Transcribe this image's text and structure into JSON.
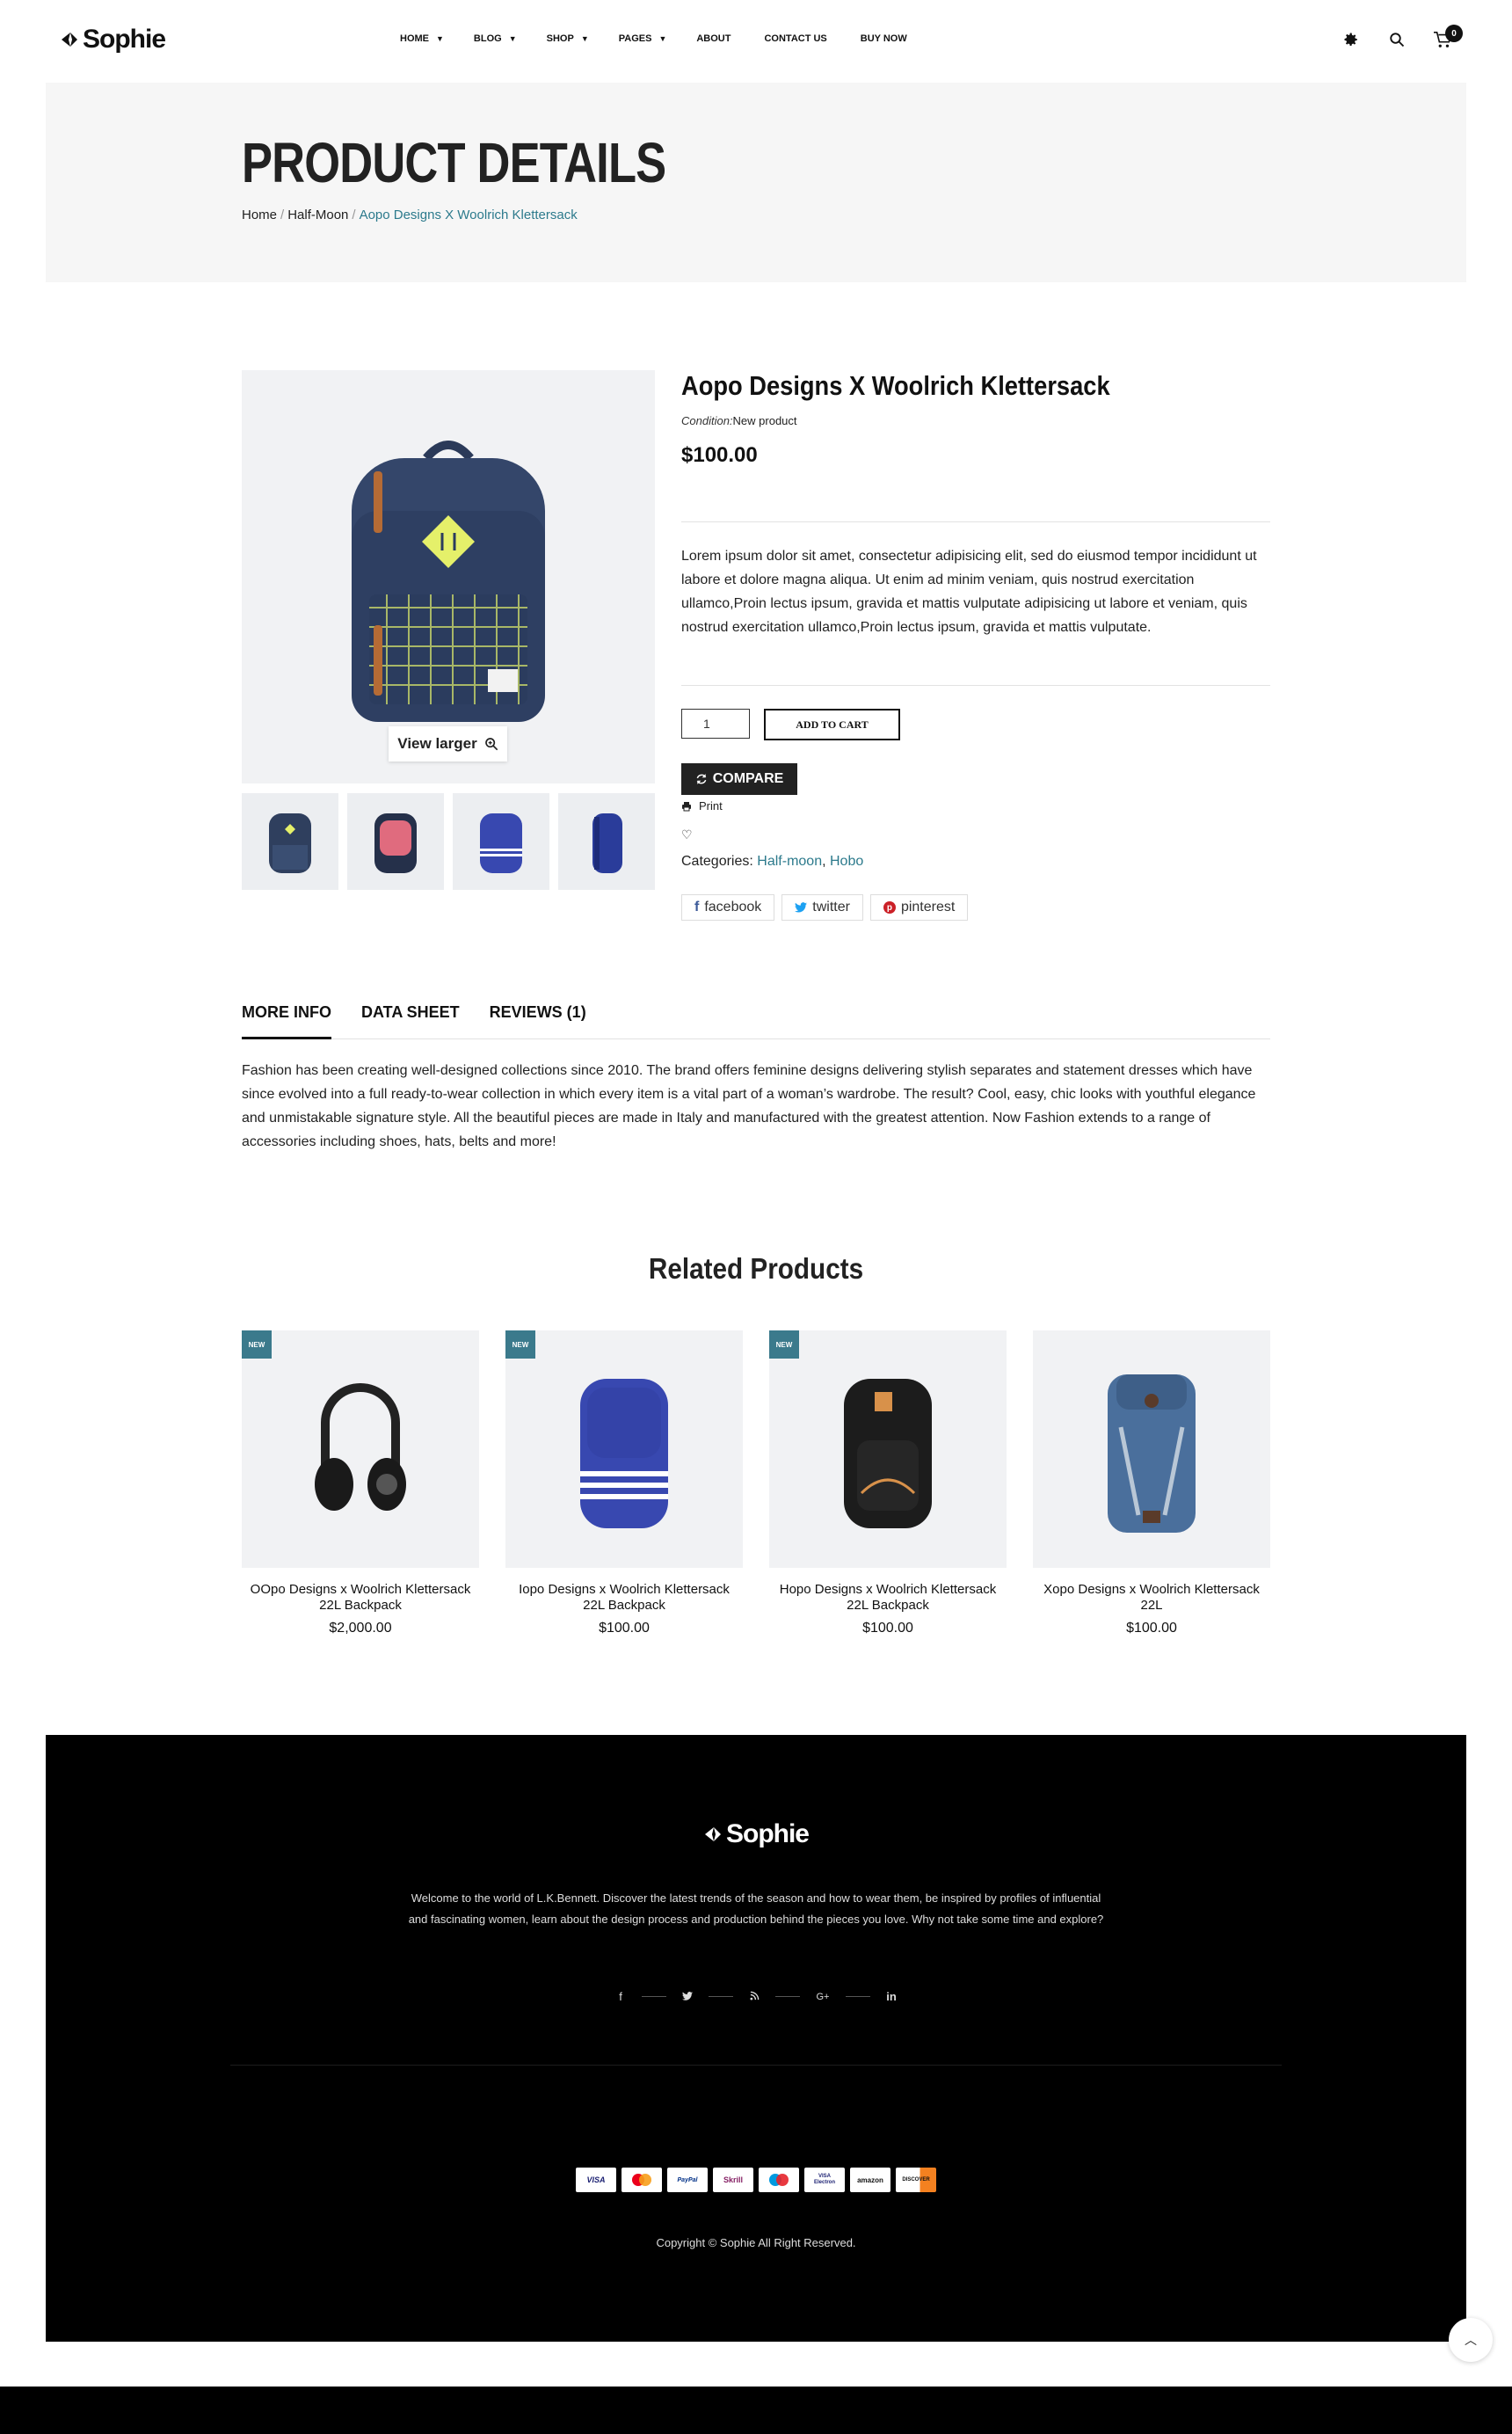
{
  "header": {
    "logo_text": "Sophie",
    "nav": [
      {
        "label": "HOME",
        "has_dropdown": true
      },
      {
        "label": "BLOG",
        "has_dropdown": true
      },
      {
        "label": "SHOP",
        "has_dropdown": true
      },
      {
        "label": "PAGES",
        "has_dropdown": true
      },
      {
        "label": "ABOUT",
        "has_dropdown": false
      },
      {
        "label": "CONTACT US",
        "has_dropdown": false
      },
      {
        "label": "BUY NOW",
        "has_dropdown": false
      }
    ],
    "icons": [
      "gear-icon",
      "search-icon",
      "cart-icon"
    ],
    "cart_count": "0"
  },
  "banner": {
    "title": "PRODUCT DETAILS",
    "breadcrumb": {
      "home": "Home",
      "category": "Half-Moon",
      "current": "Aopo Designs X Woolrich Klettersack"
    }
  },
  "product": {
    "view_larger": "View larger",
    "title": "Aopo Designs X Woolrich Klettersack",
    "condition_label": "Condition:",
    "condition_value": "New product",
    "price": "$100.00",
    "description": "Lorem ipsum dolor sit amet, consectetur adipisicing elit, sed do eiusmod tempor incididunt ut labore et dolore magna aliqua. Ut enim ad minim veniam, quis nostrud exercitation ullamco,Proin lectus ipsum, gravida et mattis vulputate adipisicing ut labore et veniam, quis nostrud exercitation ullamco,Proin lectus ipsum, gravida et mattis vulputate.",
    "quantity": "1",
    "add_to_cart": "ADD TO CART",
    "compare": "COMPARE",
    "print": "Print",
    "categories_label": "Categories:",
    "categories": [
      "Half-moon",
      "Hobo"
    ],
    "share": [
      "facebook",
      "twitter",
      "pinterest"
    ],
    "thumb_colors": [
      "#2f3f5e",
      "#e06b7e",
      "#3848b0",
      "#2a3c9a"
    ]
  },
  "tabs": {
    "items": [
      "MORE INFO",
      "DATA SHEET",
      "REVIEWS (1)"
    ],
    "active": "MORE INFO",
    "body": "Fashion has been creating well-designed collections since 2010. The brand offers feminine designs delivering stylish separates and statement dresses which have since evolved into a full ready-to-wear collection in which every item is a vital part of a woman’s wardrobe. The result? Cool, easy, chic looks with youthful elegance and unmistakable signature style. All the beautiful pieces are made in Italy and manufactured with the greatest attention. Now Fashion extends to a range of accessories including shoes, hats, belts and more!"
  },
  "related": {
    "title": "Related Products",
    "badge": "NEW",
    "items": [
      {
        "name": "OOpo Designs x Woolrich Klettersack 22L Backpack",
        "price": "$2,000.00",
        "is_new": true
      },
      {
        "name": "Iopo Designs x Woolrich Klettersack 22L Backpack",
        "price": "$100.00",
        "is_new": true
      },
      {
        "name": "Hopo Designs x Woolrich Klettersack 22L Backpack",
        "price": "$100.00",
        "is_new": true
      },
      {
        "name": "Xopo Designs x Woolrich Klettersack 22L",
        "price": "$100.00",
        "is_new": false
      }
    ]
  },
  "footer": {
    "logo_text": "Sophie",
    "text": "Welcome to the world of L.K.Bennett. Discover the latest trends of the season and how to wear them, be inspired by profiles of influential and fascinating women, learn about the design process and production behind the pieces you love. Why not take some time and explore?",
    "social": [
      "f",
      "t",
      "rss",
      "G+",
      "in"
    ],
    "payments": [
      "VISA",
      "MC",
      "PayPal",
      "Skrill",
      "Maestro",
      "VISA Electron",
      "amazon",
      "DISCOVER"
    ],
    "copyright": "Copyright © Sophie All Right Reserved."
  }
}
